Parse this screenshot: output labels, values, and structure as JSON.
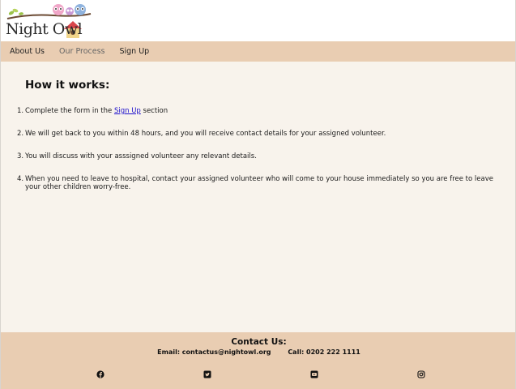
{
  "brand": {
    "name": "Night Owl"
  },
  "nav": {
    "items": [
      {
        "label": "About Us",
        "active": false
      },
      {
        "label": "Our Process",
        "active": true
      },
      {
        "label": "Sign Up",
        "active": false
      }
    ]
  },
  "main": {
    "heading": "How it works:",
    "steps": [
      {
        "num": "1.",
        "before": "Complete the form in the ",
        "link": "Sign Up",
        "after": " section"
      },
      {
        "num": "2.",
        "text": "We will get back to you within 48 hours, and you will receive contact details for your assigned volunteer."
      },
      {
        "num": "3.",
        "text": "You will discuss with your asssigned volunteer any relevant details."
      },
      {
        "num": "4.",
        "text": "When you need to leave to hospital, contact your assigned volunteer who will come to your house immediately so you are free to leave your other children worry-free."
      }
    ]
  },
  "footer": {
    "title": "Contact Us:",
    "email": "Email: contactus@nightowl.org",
    "phone": "Call: 0202 222 1111",
    "social_icons": [
      "facebook-icon",
      "twitter-icon",
      "youtube-icon",
      "instagram-icon"
    ]
  },
  "colors": {
    "nav_bg": "#e9cdb2",
    "main_bg": "#f8f3ec",
    "link": "#1a0dcc"
  }
}
